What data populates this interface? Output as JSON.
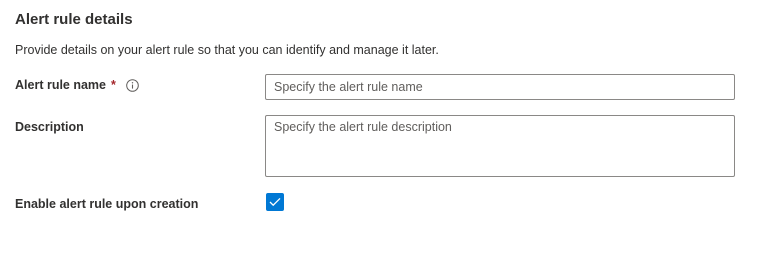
{
  "section": {
    "title": "Alert rule details",
    "description": "Provide details on your alert rule so that you can identify and manage it later."
  },
  "fields": {
    "name": {
      "label": "Alert rule name",
      "required_mark": "*",
      "info_icon": "info-icon",
      "value": "",
      "placeholder": "Specify the alert rule name"
    },
    "description": {
      "label": "Description",
      "value": "",
      "placeholder": "Specify the alert rule description"
    },
    "enable": {
      "label": "Enable alert rule upon creation",
      "checked": true,
      "icon": "checkmark-icon"
    }
  },
  "colors": {
    "required": "#a4262c",
    "checkbox_fill": "#0078d4",
    "input_border": "#8a8886",
    "text": "#323130",
    "placeholder": "#605e5c"
  }
}
